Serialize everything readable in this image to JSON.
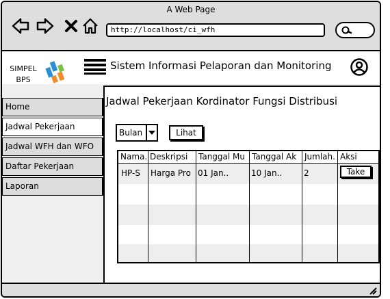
{
  "browser": {
    "window_title": "A Web Page",
    "url": "http://localhost/ci_wfh",
    "icons": [
      "back-arrow-icon",
      "forward-arrow-icon",
      "close-icon",
      "home-icon",
      "search-icon"
    ]
  },
  "header": {
    "logo_line1": "SIMPEL",
    "logo_line2": "BPS",
    "app_title": "Sistem Informasi Pelaporan dan Monitoring"
  },
  "sidebar": {
    "items": [
      {
        "label": "Home"
      },
      {
        "label": "Jadwal Pekerjaan"
      },
      {
        "label": "Jadwal WFH dan WFO"
      },
      {
        "label": "Daftar Pekerjaan"
      },
      {
        "label": "Laporan"
      }
    ]
  },
  "main": {
    "title": "Jadwal Pekerjaan Kordinator Fungsi Distribusi",
    "filter_value": "Bulan",
    "view_button": "Lihat",
    "table": {
      "columns": [
        "Nama.",
        "Deskripsi",
        "Tanggal Mu",
        "Tanggal Ak",
        "Jumlah.",
        "Aksi"
      ],
      "rows": [
        {
          "nama": "HP-S",
          "deskripsi": "Harga Pro",
          "mulai": "01 Jan..",
          "akhir": "10 Jan..",
          "jumlah": "2",
          "aksi": "Take"
        }
      ]
    }
  }
}
